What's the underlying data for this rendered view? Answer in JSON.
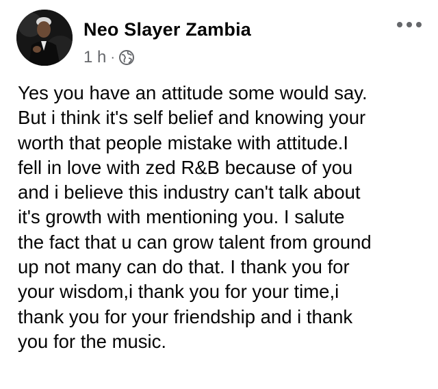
{
  "post": {
    "author": "Neo Slayer Zambia",
    "time": "1 h",
    "separator": "·",
    "audience_icon": "globe-icon",
    "more_icon": "more-options-icon",
    "message_lines": [
      "Yes you have an attitude some would say.",
      "But i think it's self belief and knowing your",
      "worth that people mistake with attitude.I",
      "fell in love with zed R&B because of you",
      "and i believe this industry can't talk about",
      "it's growth with mentioning you. I salute",
      "the fact that u can grow talent from ground",
      "up not many can do that. I thank you for",
      "your wisdom,i thank you for your time,i",
      "thank you for your friendship and i thank",
      "you for the music."
    ]
  },
  "colors": {
    "text_primary": "#050505",
    "text_secondary": "#65676b",
    "background": "#ffffff"
  }
}
